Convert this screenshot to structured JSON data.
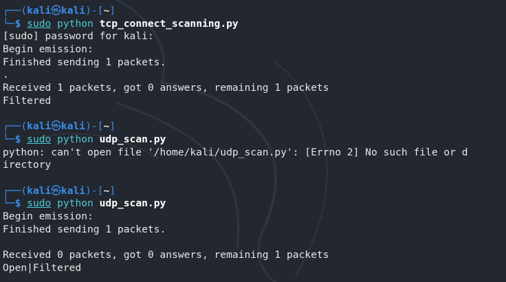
{
  "window": {
    "background": "#23272f",
    "prompt_color": "#3b8eea",
    "command_color": "#4ec9d8",
    "output_color": "#e6e6e6"
  },
  "prompt": {
    "user": "kali",
    "host": "kali",
    "directory": "~",
    "at_icon": "kali-at-icon"
  },
  "blocks": [
    {
      "command": {
        "sudo": "sudo",
        "interpreter": "python",
        "argument": "tcp_connect_scanning.py"
      },
      "output": [
        "[sudo] password for kali:",
        "Begin emission:",
        "Finished sending 1 packets.",
        ".",
        "Received 1 packets, got 0 answers, remaining 1 packets",
        "Filtered"
      ]
    },
    {
      "command": {
        "sudo": "sudo",
        "interpreter": "python",
        "argument": "udp_scan.py"
      },
      "output": [
        "python: can't open file '/home/kali/udp_scan.py': [Errno 2] No such file or d",
        "irectory"
      ]
    },
    {
      "command": {
        "sudo": "sudo",
        "interpreter": "python",
        "argument": "udp_scan.py"
      },
      "output": [
        "Begin emission:",
        "Finished sending 1 packets.",
        "",
        "Received 0 packets, got 0 answers, remaining 1 packets",
        "Open|Filtered"
      ]
    }
  ]
}
